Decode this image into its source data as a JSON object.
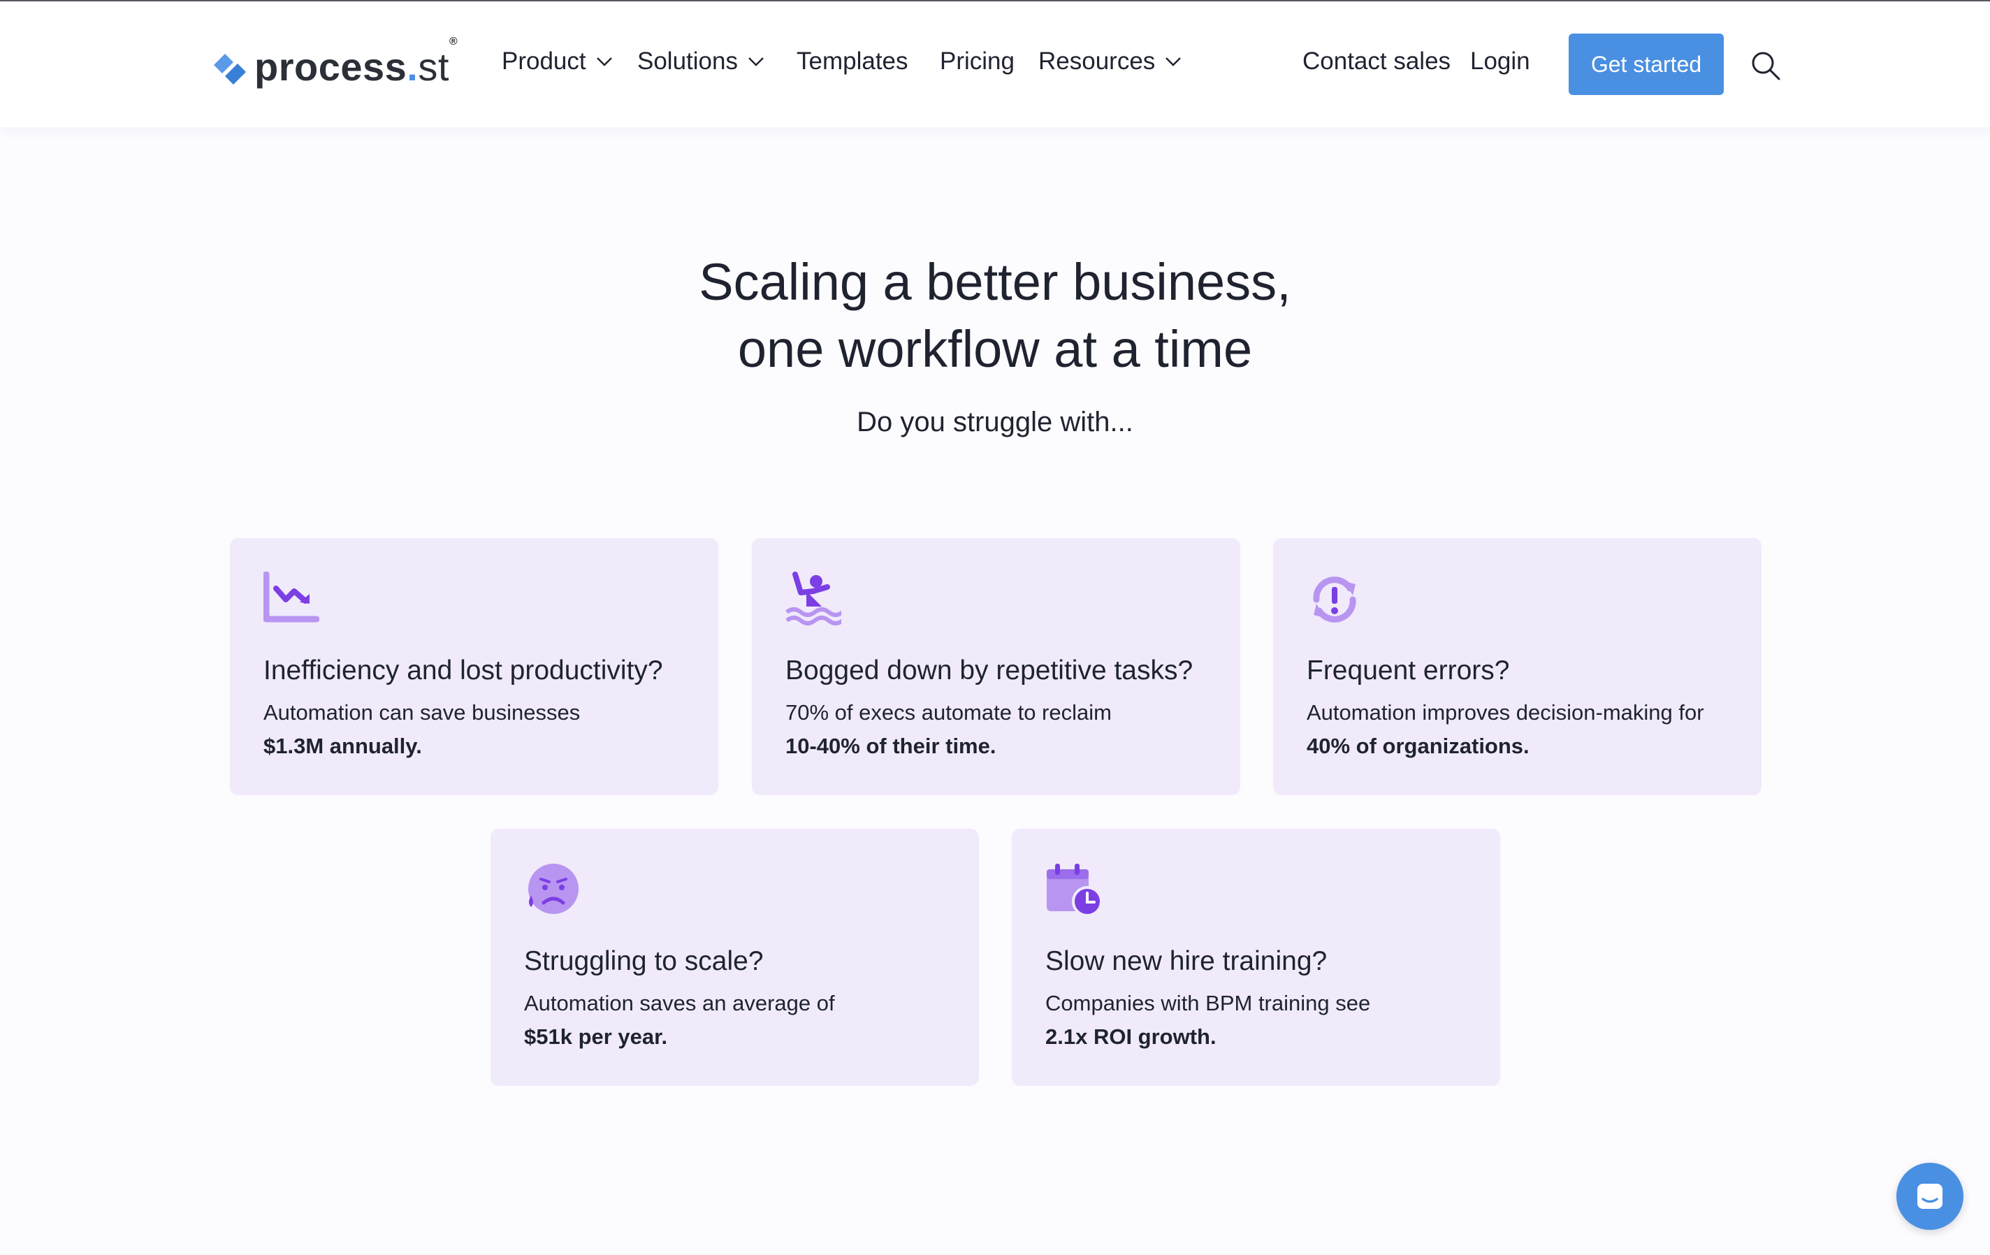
{
  "header": {
    "logo": {
      "name": "process",
      "dot": ".",
      "suffix": "st",
      "reg": "®"
    },
    "nav": [
      {
        "label": "Product"
      },
      {
        "label": "Solutions"
      },
      {
        "label": "Templates"
      },
      {
        "label": "Pricing"
      },
      {
        "label": "Resources"
      }
    ],
    "contact_sales": "Contact sales",
    "login": "Login",
    "get_started": "Get started"
  },
  "hero": {
    "title_line1": "Scaling a better business,",
    "title_line2": "one workflow at a time",
    "subtitle": "Do you struggle with..."
  },
  "cards": [
    {
      "icon": "chart-down-icon",
      "title": "Inefficiency and lost productivity?",
      "body": "Automation can save businesses",
      "bold": "$1.3M annually."
    },
    {
      "icon": "drowning-person-icon",
      "title": "Bogged down by repetitive tasks?",
      "body": "70% of execs automate to reclaim",
      "bold": "10-40% of their time."
    },
    {
      "icon": "sync-error-icon",
      "title": "Frequent errors?",
      "body": "Automation improves decision-making for",
      "bold": "40% of organizations."
    },
    {
      "icon": "sad-face-icon",
      "title": "Struggling to scale?",
      "body": "Automation saves an average of",
      "bold": "$51k per year."
    },
    {
      "icon": "calendar-clock-icon",
      "title": "Slow new hire training?",
      "body": "Companies with BPM training see",
      "bold": "2.1x ROI growth."
    }
  ],
  "colors": {
    "accent": "#4a90e2",
    "card_bg": "#f0eafb",
    "icon_purple": "#7b3fe4",
    "icon_light": "#b895f0"
  }
}
